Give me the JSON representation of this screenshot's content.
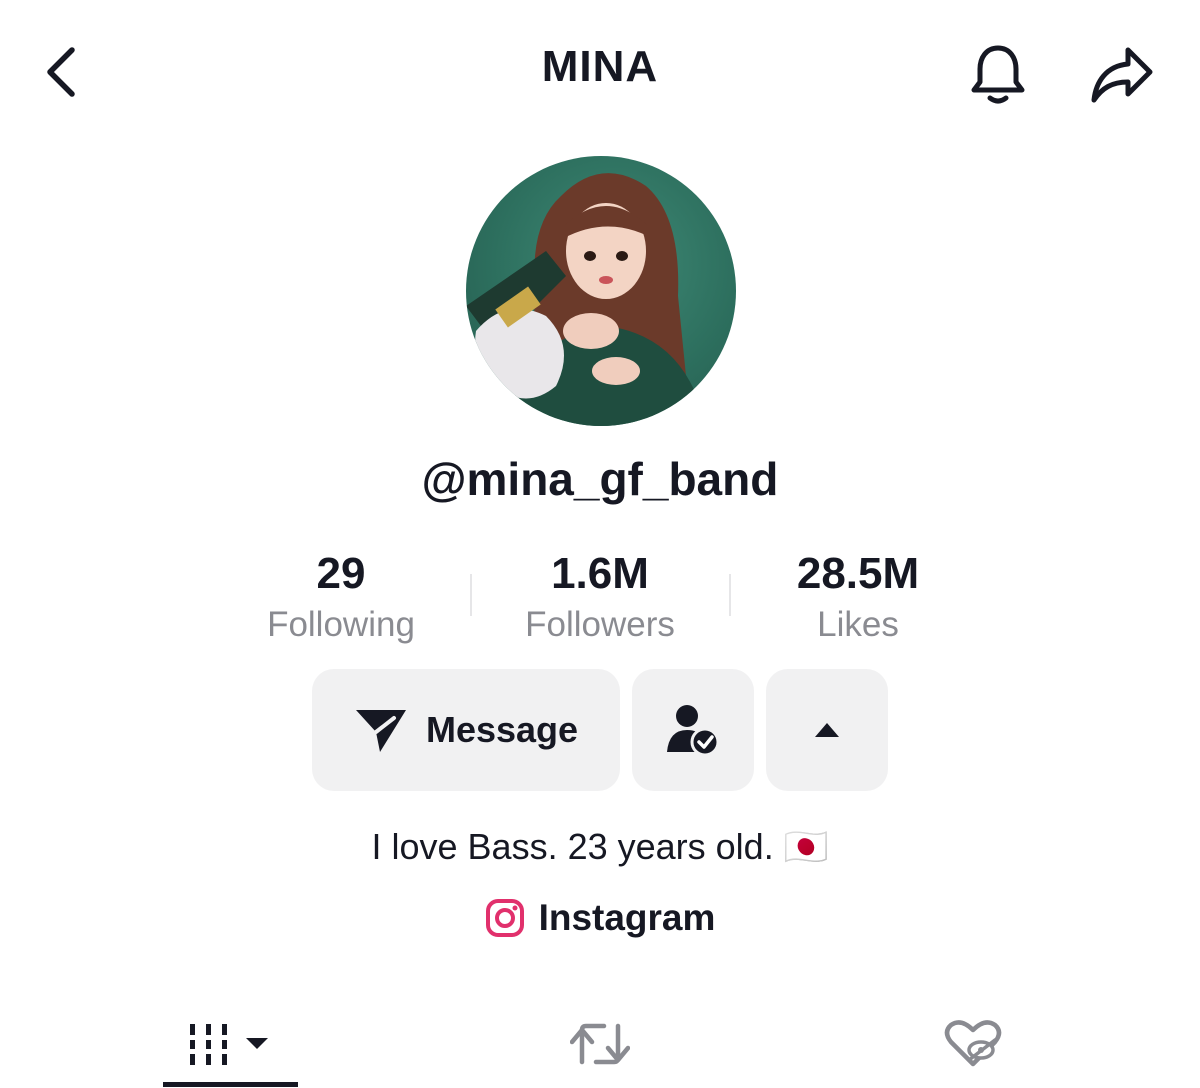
{
  "header": {
    "title": "MINA",
    "back_icon": "chevron-left-icon",
    "bell_icon": "bell-icon",
    "share_icon": "share-arrow-icon"
  },
  "profile": {
    "username": "@mina_gf_band",
    "avatar_description_icon": "profile-photo"
  },
  "stats": [
    {
      "value": "29",
      "label": "Following"
    },
    {
      "value": "1.6M",
      "label": "Followers"
    },
    {
      "value": "28.5M",
      "label": "Likes"
    }
  ],
  "actions": {
    "message_label": "Message",
    "message_icon": "send-icon",
    "friend_icon": "user-check-icon",
    "more_icon": "caret-up-icon"
  },
  "bio": {
    "text": "I love Bass. 23 years old. 🇯🇵"
  },
  "links": {
    "instagram_label": "Instagram",
    "instagram_icon": "instagram-icon"
  },
  "tabs": [
    {
      "name": "videos",
      "icon": "grid-icon",
      "active": true
    },
    {
      "name": "reposts",
      "icon": "repost-icon",
      "active": false
    },
    {
      "name": "liked",
      "icon": "heart-hidden-icon",
      "active": false
    }
  ],
  "colors": {
    "text": "#161823",
    "muted": "#8a8b91",
    "button_bg": "#f1f1f2",
    "instagram": "#e1306c"
  }
}
